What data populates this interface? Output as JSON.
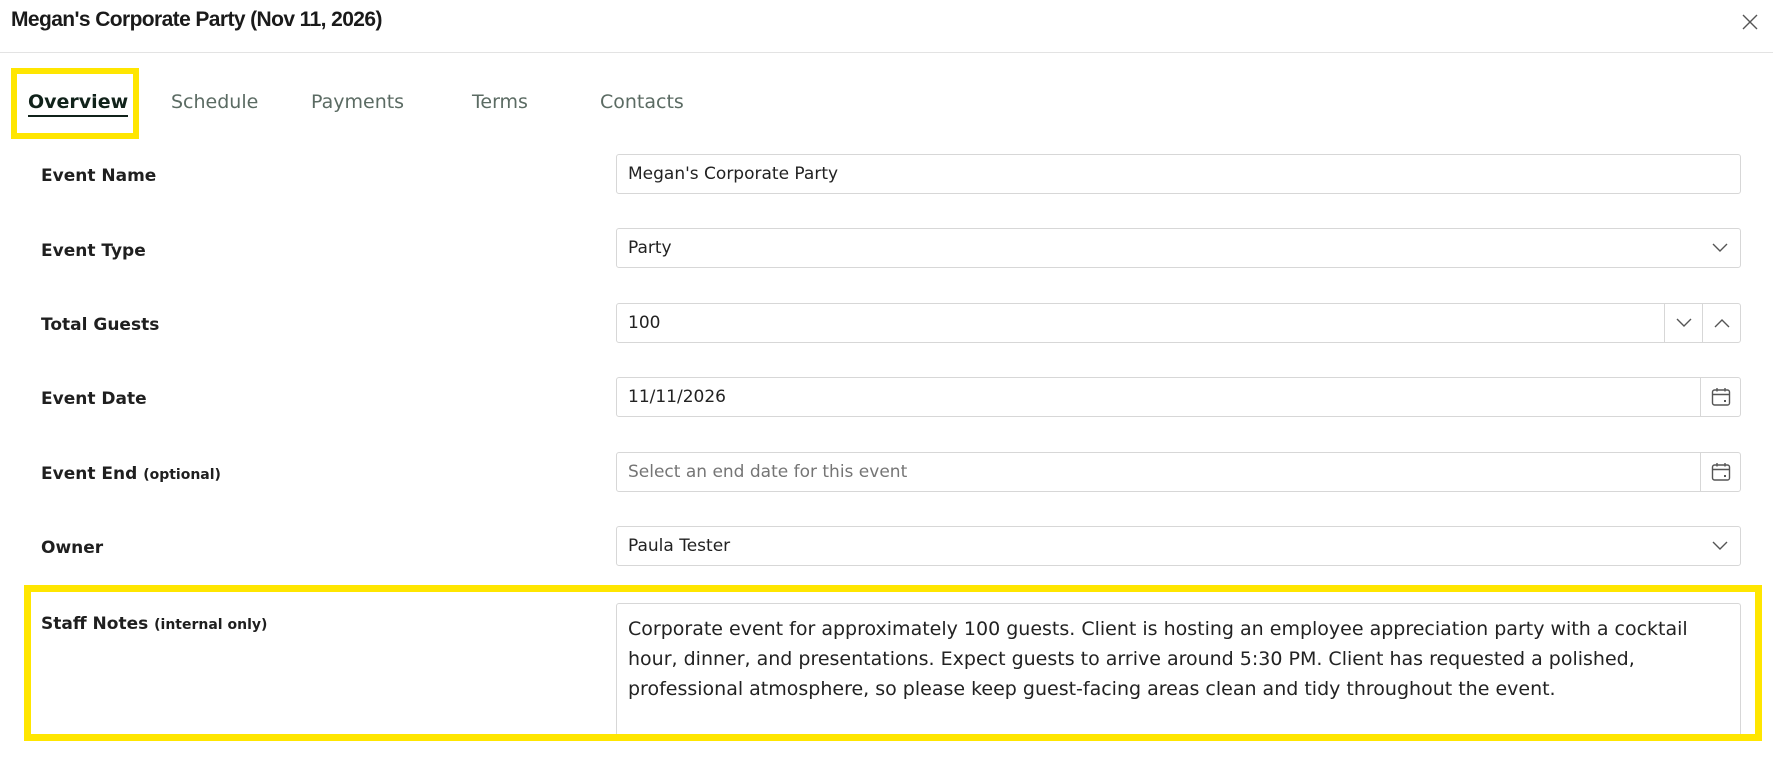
{
  "dialog": {
    "title": "Megan's Corporate Party (Nov 11, 2026)"
  },
  "tabs": [
    {
      "label": "Overview",
      "active": true
    },
    {
      "label": "Schedule",
      "active": false
    },
    {
      "label": "Payments",
      "active": false
    },
    {
      "label": "Terms",
      "active": false
    },
    {
      "label": "Contacts",
      "active": false
    }
  ],
  "form": {
    "event_name": {
      "label": "Event Name",
      "value": "Megan's Corporate Party"
    },
    "event_type": {
      "label": "Event Type",
      "value": "Party"
    },
    "total_guests": {
      "label": "Total Guests",
      "value": "100"
    },
    "event_date": {
      "label": "Event Date",
      "value": "11/11/2026"
    },
    "event_end": {
      "label": "Event End",
      "hint": "(optional)",
      "placeholder": "Select an end date for this event"
    },
    "owner": {
      "label": "Owner",
      "value": "Paula Tester"
    },
    "staff_notes": {
      "label": "Staff Notes",
      "hint": "(internal only)",
      "value": "Corporate event for approximately 100 guests. Client is hosting an employee appreciation party with a cocktail hour, dinner, and presentations. Expect guests to arrive around 5:30 PM. Client has requested a polished, professional atmosphere, so please keep guest-facing areas clean and tidy throughout the event."
    }
  },
  "colors": {
    "highlight": "#ffe600",
    "active_tab": "#10221a",
    "inactive_tab": "#5b6b63",
    "border": "#d7d7d7"
  },
  "icons": {
    "close": "close-icon",
    "dropdown": "chevron-down-icon",
    "stepper_down": "chevron-down-icon",
    "stepper_up": "chevron-up-icon",
    "calendar": "calendar-icon"
  }
}
